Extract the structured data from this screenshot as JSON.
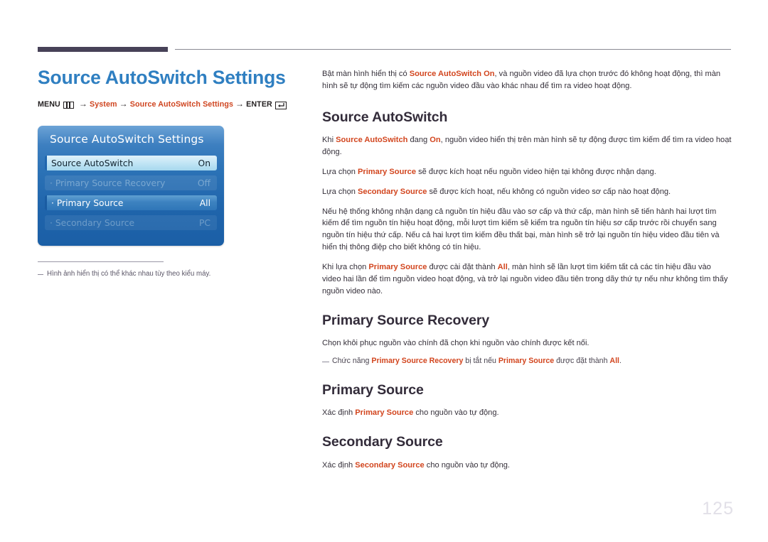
{
  "document": {
    "page_number": "125"
  },
  "header": {
    "title": "Source AutoSwitch Settings",
    "title_color": "#2f7fc1",
    "rule_color": "#474258"
  },
  "breadcrumb": {
    "menu_label": "MENU",
    "menu_icon": "menu-grid-icon",
    "arrow": "→",
    "item1": "System",
    "item2": "Source AutoSwitch Settings",
    "enter_label": "ENTER",
    "enter_icon": "enter-return-icon",
    "accent_color": "#cf4520"
  },
  "osd": {
    "title": "Source AutoSwitch Settings",
    "rows": [
      {
        "label": "Source AutoSwitch",
        "value": "On",
        "state": "selected"
      },
      {
        "label": "· Primary Source Recovery",
        "value": "Off",
        "state": "disabled"
      },
      {
        "label": "· Primary Source",
        "value": "All",
        "state": "active"
      },
      {
        "label": "· Secondary Source",
        "value": "PC",
        "state": "disabled"
      }
    ]
  },
  "left_note": {
    "text": "Hình ảnh hiển thị có thể khác nhau tùy theo kiểu máy."
  },
  "main": {
    "intro": {
      "a": "Bật màn hình hiển thị có ",
      "kw1": "Source AutoSwitch On",
      "b": ", và nguồn video đã lựa chọn trước đó không hoạt động, thì màn hình sẽ tự động tìm kiếm các nguồn video đầu vào khác nhau để tìm ra video hoạt động."
    },
    "sections": [
      {
        "heading": "Source AutoSwitch",
        "paragraphs": [
          {
            "a": "Khi ",
            "kw1": "Source AutoSwitch",
            "b": " đang ",
            "kw2": "On",
            "c": ", nguồn video hiển thị trên màn hình sẽ tự động được tìm kiếm để tìm ra video hoạt động."
          },
          {
            "a": "Lựa chọn ",
            "kw1": "Primary Source",
            "b": " sẽ được kích hoạt nếu nguồn video hiện tại không được nhận dạng."
          },
          {
            "a": "Lựa chọn ",
            "kw1": "Secondary Source",
            "b": " sẽ được kích hoạt, nếu không có nguồn video sơ cấp nào hoạt động."
          },
          {
            "a": "Nếu hệ thống không nhận dạng cả nguồn tín hiệu đầu vào sơ cấp và thứ cấp, màn hình sẽ tiến hành hai lượt tìm kiếm để tìm nguồn tín hiệu hoạt động, mỗi lượt tìm kiếm sẽ kiểm tra nguồn tín hiệu sơ cấp trước rồi chuyển sang nguồn tín hiệu thứ cấp. Nếu cả hai lượt tìm kiếm đều thất bại, màn hình sẽ trở lại nguồn tín hiệu video đầu tiên và hiển thị thông điệp cho biết không có tín hiệu."
          },
          {
            "a": "Khi lựa chọn ",
            "kw1": "Primary Source",
            "b": " được cài đặt thành ",
            "kw2": "All",
            "c": ", màn hình sẽ lần lượt tìm kiếm tất cả các tín hiệu đầu vào video hai lần để tìm nguồn video hoạt động, và trở lại nguồn video đầu tiên trong dãy thứ tự nếu như không tìm thấy nguồn video nào."
          }
        ]
      },
      {
        "heading": "Primary Source Recovery",
        "body": "Chọn khôi phục nguồn vào chính đã chọn khi nguồn vào chính được kết nối.",
        "note": {
          "a": "Chức năng ",
          "kw1": "Primary Source Recovery",
          "b": " bị tắt nếu ",
          "kw2": "Primary Source",
          "c": " được đặt thành ",
          "kw3": "All",
          "d": "."
        }
      },
      {
        "heading": "Primary Source",
        "body_parts": {
          "a": "Xác định ",
          "kw1": "Primary Source",
          "b": " cho nguồn vào tự động."
        }
      },
      {
        "heading": "Secondary Source",
        "body_parts": {
          "a": "Xác định ",
          "kw1": "Secondary Source",
          "b": " cho nguồn vào tự động."
        }
      }
    ]
  }
}
